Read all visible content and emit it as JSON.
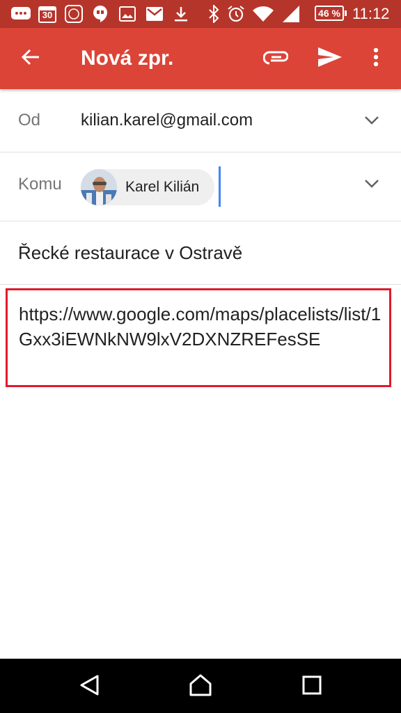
{
  "status_bar": {
    "calendar_day": "30",
    "battery_percent": "46 %",
    "time": "11:12",
    "icons": [
      "chat-icon",
      "calendar-icon",
      "mi-icon",
      "hangouts-icon",
      "gallery-icon",
      "gmail-icon",
      "download-icon",
      "bluetooth-icon",
      "alarm-icon",
      "wifi-icon",
      "signal-icon",
      "battery-icon"
    ]
  },
  "app_bar": {
    "title": "Nová zpr.",
    "icons": [
      "back-arrow-icon",
      "attach-icon",
      "send-icon",
      "more-vert-icon"
    ]
  },
  "compose": {
    "from_label": "Od",
    "from_value": "kilian.karel@gmail.com",
    "to_label": "Komu",
    "to_chip_name": "Karel Kilián",
    "subject": "Řecké restaurace v Ostravě",
    "body": "https://www.google.com/maps/placelists/list/1Gxx3iEWNkNW9lxV2DXNZREFesSE"
  },
  "nav_bar": {
    "icons": [
      "back-triangle-icon",
      "home-icon",
      "recents-icon"
    ]
  },
  "colors": {
    "status_bar": "#b6352b",
    "app_bar": "#db4437",
    "highlight_border": "#e01a2b",
    "caret": "#4285f4"
  }
}
